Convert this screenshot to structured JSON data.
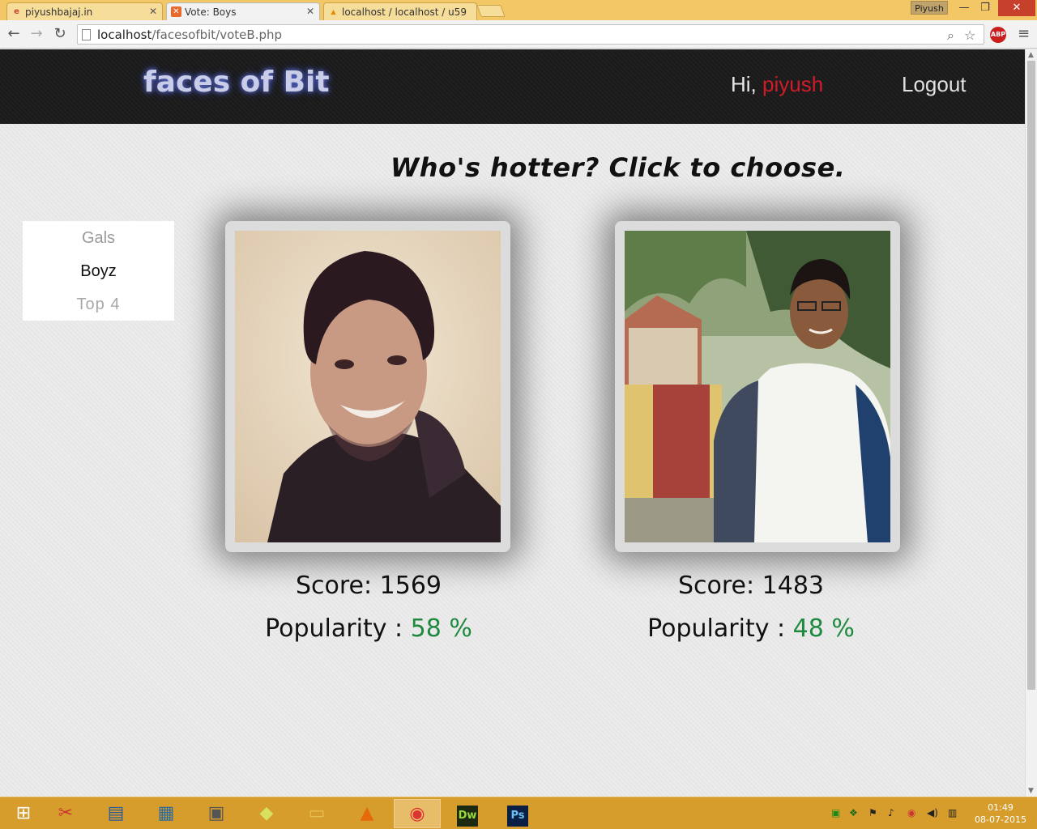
{
  "browser": {
    "tabs": [
      {
        "title": "piyushbajaj.in",
        "active": false
      },
      {
        "title": "Vote: Boys",
        "active": true
      },
      {
        "title": "localhost / localhost / u59",
        "active": false
      }
    ],
    "profile_name": "Piyush",
    "url_host": "localhost",
    "url_path": "/facesofbit/voteB.php",
    "abp_label": "ABP"
  },
  "site": {
    "logo": "faces of Bit",
    "greeting": "Hi,",
    "username": "piyush",
    "logout_label": "Logout",
    "headline": "Who's hotter? Click to choose."
  },
  "side_menu": {
    "items": [
      {
        "label": "Gals"
      },
      {
        "label": "Boyz"
      },
      {
        "label": "Top  4"
      }
    ]
  },
  "contestants": [
    {
      "score_label": "Score:",
      "score": "1569",
      "popularity_label": "Popularity :",
      "popularity": "58 %"
    },
    {
      "score_label": "Score:",
      "score": "1483",
      "popularity_label": "Popularity :",
      "popularity": "48 %"
    }
  ],
  "taskbar": {
    "time": "01:49",
    "date": "08-07-2015",
    "apps": [
      "start-icon",
      "paint-icon",
      "monitor-icon",
      "control-panel-icon",
      "calculator-icon",
      "sticky-notes-icon",
      "file-explorer-icon",
      "vlc-icon",
      "chrome-icon",
      "dreamweaver-icon",
      "photoshop-icon"
    ],
    "dw_label": "Dw",
    "ps_label": "Ps"
  },
  "colors": {
    "username": "#d01c28",
    "popularity": "#1e8a3e",
    "header_bg": "#1e1e1e",
    "taskbar": "#d69d2d"
  }
}
